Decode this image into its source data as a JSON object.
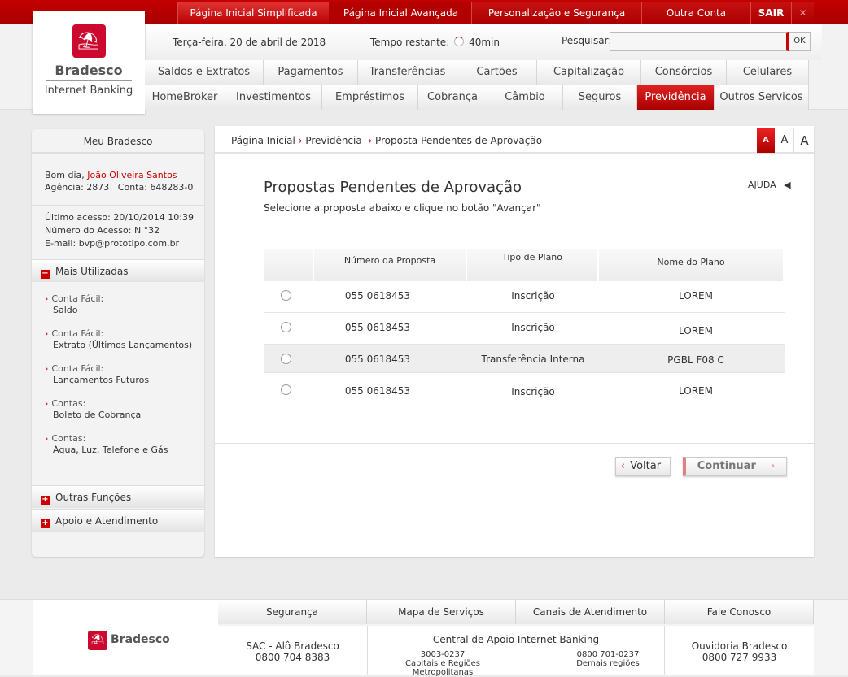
{
  "topnav": [
    "Página Inicial Simplificada",
    "Página Inicial Avançada",
    "Personalização e Segurança",
    "Outra Conta",
    "SAIR"
  ],
  "logo": {
    "brand": "Bradesco",
    "subtitle": "Internet Banking"
  },
  "header": {
    "date": "Terça-feira, 20 de abril de 2018",
    "time_label": "Tempo restante:",
    "time_value": "40min",
    "search_label": "Pesquisar:",
    "search_value": "",
    "search_button": "OK"
  },
  "menu_row1": [
    "Saldos e Extratos",
    "Pagamentos",
    "Transferências",
    "Cartões",
    "Capitalização",
    "Consórcios",
    "Celulares"
  ],
  "menu_row2": [
    "HomeBroker",
    "Investimentos",
    "Empréstimos",
    "Cobrança",
    "Câmbio",
    "Seguros",
    "Previdência",
    "Outros Serviços"
  ],
  "sidebar": {
    "title": "Meu Bradesco",
    "greeting": "Bom dia, ",
    "user": "João Oliveira Santos",
    "agencia": "Agência: 2873",
    "conta": "Conta: 648283-0",
    "last_access": "Último acesso: 20/10/2014 10:39",
    "access_number": "Número do Acesso: N °32",
    "email": "E-mail: bvp@prototipo.com.br",
    "section_open": "Mais Utilizadas",
    "items": [
      {
        "a": "Conta Fácil:",
        "b": "Saldo"
      },
      {
        "a": "Conta Fácil:",
        "b": "Extrato (Últimos Lançamentos)"
      },
      {
        "a": "Conta Fácil:",
        "b": "Lançamentos Futuros"
      },
      {
        "a": "Contas:",
        "b": "Boleto de Cobrança"
      },
      {
        "a": "Contas:",
        "b": "Água, Luz, Telefone e Gás"
      }
    ],
    "section2": "Outras Funções",
    "section3": "Apoio e Atendimento"
  },
  "breadcrumb": [
    "Página Inicial",
    "Previdência",
    "Proposta Pendentes de Aprovação"
  ],
  "font_sizes": [
    "A",
    "A",
    "A"
  ],
  "main": {
    "title": "Propostas Pendentes de Aprovação",
    "subtitle": "Selecione a proposta abaixo e clique no botão \"Avançar\"",
    "help": "AJUDA",
    "columns": [
      "Número da Proposta",
      "Tipo de Plano",
      "Nome do Plano"
    ],
    "rows": [
      [
        "055 0618453",
        "Inscrição",
        "LOREM"
      ],
      [
        "055 0618453",
        "Inscrição",
        "LOREM"
      ],
      [
        "055 0618453",
        "Transferência Interna",
        "PGBL F08 C"
      ],
      [
        "055 0618453",
        "Inscrição",
        "LOREM"
      ]
    ],
    "back": "Voltar",
    "next": "Continuar"
  },
  "footer": {
    "tabs": [
      "Segurança",
      "Mapa de Serviços",
      "Canais de Atendimento",
      "Fale Conosco"
    ],
    "brand": "Bradesco",
    "sac_title": "SAC - Alô Bradesco",
    "sac_phone": "0800 704 8383",
    "central_title": "Central de Apoio Internet Banking",
    "central_phone1": "3003-0237",
    "central_desc1": "Capitais e Regiões Metropolitanas",
    "central_phone2": "0800 701-0237",
    "central_desc2": "Demais regiões",
    "ouv_title": "Ouvidoria Bradesco",
    "ouv_phone": "0800 727 9933"
  },
  "colors": {
    "brand_red": "#cc092f",
    "accent": "#c00000"
  }
}
